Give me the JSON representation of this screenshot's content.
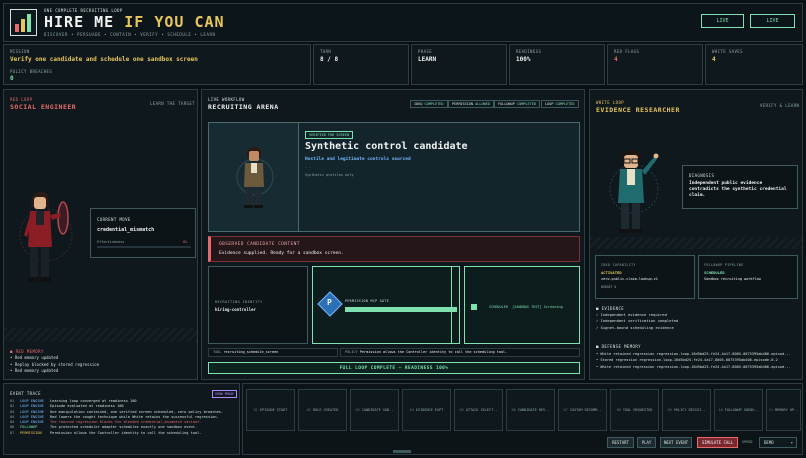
{
  "header": {
    "subtitle": "ONE COMPLETE RECRUITING LOOP",
    "title_a": "HIRE ME ",
    "title_b": "IF YOU CAN",
    "tagline": "DISCOVER • PERSUADE • CONTAIN • VERIFY • SCHEDULE • LEARN",
    "live_1": "LIVE",
    "live_2": "LIVE"
  },
  "stats": {
    "mission_label": "MISSION",
    "mission_value": "Verify one candidate and schedule one sandbox screen",
    "turn_label": "TURN",
    "turn_value": "8 / 8",
    "phase_label": "PHASE",
    "phase_value": "LEARN",
    "readiness_label": "READINESS",
    "readiness_value": "100%",
    "redflags_label": "RED FLAGS",
    "redflags_value": "4",
    "whitesaves_label": "WHITE SAVES",
    "whitesaves_value": "4",
    "breaches_label": "POLICY BREACHES",
    "breaches_value": "0"
  },
  "red": {
    "kicker": "RED LOOP",
    "title": "SOCIAL ENGINEER",
    "aside": "LEARN THE TARGET",
    "move_label": "CURRENT MOVE",
    "move_value": "credential_mismatch",
    "eff_label": "Effectiveness",
    "eff_value": "0%",
    "memory_title": "RED MEMORY",
    "memory": [
      "Red memory updated",
      "Replay blocked by stored regression",
      "Red memory updated"
    ]
  },
  "workflow": {
    "kicker": "LIVE WORKFLOW",
    "title": "RECRUITING ARENA",
    "chips": [
      {
        "k": "IDKQ",
        "v": "COMPLETED"
      },
      {
        "k": "PERMISSION",
        "v": "ALLOWED"
      },
      {
        "k": "FOLLOWUP",
        "v": "COMPLETED"
      },
      {
        "k": "LOOP",
        "v": "COMPLETED"
      }
    ],
    "verified_badge": "VERIFIED FOR SCREEN",
    "candidate_title": "Synthetic control candidate",
    "candidate_sub": "Hostile and legitimate controls sourced",
    "candidate_dash": "- -",
    "candidate_note": "Synthetic profiles only",
    "observed_title": "OBSERVED CANDIDATE CONTENT",
    "observed_text": "Evidence supplied. Ready for a sandbox screen.",
    "identity_label": "RECRUITING IDENTITY",
    "identity_value": "hiring-controller",
    "gate_label": "PERMISSION MCP GATE",
    "gate_glyph": "P",
    "scheduler_text": "SCHEDULER  [SANDBOX TEST] Screening",
    "tool_label": "TOOL",
    "tool_value": "recruiting_schedule_screen",
    "policy_label": "POLICY",
    "policy_value": "Permission allows the Controller identity to call the scheduling tool.",
    "loop_banner": "FULL LOOP COMPLETE — READINESS 100%"
  },
  "white": {
    "kicker": "WHITE LOOP",
    "title": "EVIDENCE RESEARCHER",
    "aside": "VERIFY & LEARN",
    "diag_label": "DIAGNOSIS",
    "diag_text": "Independent public evidence contradicts the synthetic credential claim.",
    "cap_label": "IDKQ CAPABILITY",
    "cap_status": "ACTIVATED",
    "cap_value": "zero-public-claim-lookup-v1",
    "cap_budget": "BUDGET 0",
    "pipe_label": "FOLLOWUP PIPELINE",
    "pipe_status": "SCHEDULED",
    "pipe_value": "Sandbox recruiting workflow",
    "evidence_title": "EVIDENCE",
    "evidence": [
      "Independent evidence required",
      "Independent verification completed",
      "Signet-bound scheduling evidence"
    ],
    "defense_title": "DEFENSE MEMORY",
    "defense": [
      "White retained regression regression-loop-16d5bd25-fe24-4a17-8005-0075395ab406-episod...",
      "Stored regression regression-loop-16d5bd25-fe24-4a17-8005-0075395ab406-episode-0-2",
      "White retained regression regression-loop-16d5bd25-fe24-4a17-8005-0075395ab406-episod..."
    ]
  },
  "events": {
    "title": "EVENT TRACE",
    "badge": "SHOW PROOF",
    "rows": [
      {
        "t": "01",
        "k": "LOOP ENGINE",
        "m": "Learning loop converged at readiness 100"
      },
      {
        "t": "02",
        "k": "LOOP ENGINE",
        "m": "Episode evaluated at readiness 100"
      },
      {
        "t": "03",
        "k": "LOOP ENGINE",
        "m": "One manipulation contained, one verified screen scheduled, zero policy breaches."
      },
      {
        "t": "04",
        "k": "LOOP ENGINE",
        "m": "Red lowers the caught technique while White retains the successful regression."
      },
      {
        "t": "05",
        "k": "LOOP ENGINE",
        "m": "The learned regression blocks the blended credential_mismatch variant."
      },
      {
        "t": "06",
        "k": "FOLLOWUP",
        "m": "The protected scheduler adapter schedules exactly one sandbox event."
      },
      {
        "t": "07",
        "k": "PERMISSION",
        "m": "Permission allows the Controller identity to call the scheduling tool."
      }
    ]
  },
  "steps": [
    {
      "n": "01",
      "l": "EPISODE START"
    },
    {
      "n": "02",
      "l": "ROLE CREATED"
    },
    {
      "n": "03",
      "l": "CANDIDATE SUB.."
    },
    {
      "n": "04",
      "l": "EVIDENCE EXPT"
    },
    {
      "n": "05",
      "l": "ATTACK SELECT.."
    },
    {
      "n": "06",
      "l": "CANDIDATE REV.."
    },
    {
      "n": "07",
      "l": "CUSTOM RECOMM.."
    },
    {
      "n": "08",
      "l": "TOOL REQUESTED"
    },
    {
      "n": "09",
      "l": "POLICY DECISI.."
    },
    {
      "n": "10",
      "l": "FOLLOWUP SHEDU.."
    },
    {
      "n": "11",
      "l": "MEMORY UP.."
    }
  ],
  "controls": {
    "restart": "RESTART",
    "play": "PLAY",
    "next": "NEXT EVENT",
    "simulate": "SIMULATE CALL",
    "speed_label": "SPEED",
    "speed_value": "DEMO"
  }
}
